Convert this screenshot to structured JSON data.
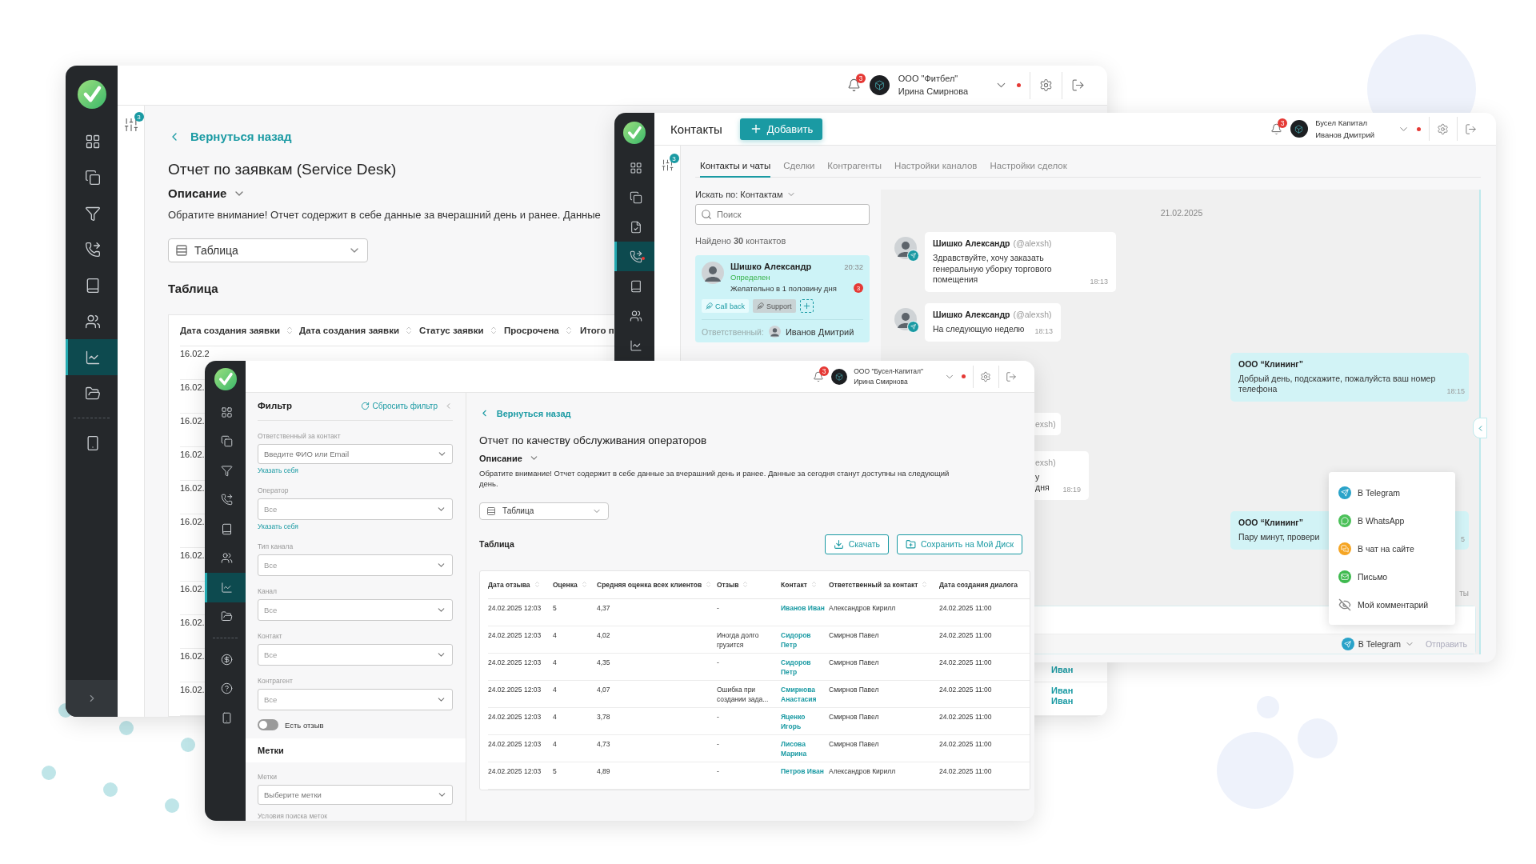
{
  "back_window": {
    "sidebar": {
      "items": [
        {
          "kind": "grid",
          "selected": false
        },
        {
          "kind": "clipboard",
          "selected": false
        },
        {
          "kind": "funnel",
          "selected": false
        },
        {
          "kind": "phone",
          "selected": false
        },
        {
          "kind": "book",
          "selected": false
        },
        {
          "kind": "people",
          "selected": false
        },
        {
          "kind": "chart",
          "selected": true
        },
        {
          "kind": "folder",
          "selected": false
        }
      ],
      "extra_items": [
        {
          "kind": "mobile",
          "selected": false
        }
      ]
    },
    "filter_badge": "3",
    "header": {
      "notification_count": "3",
      "org": "ООО \"Фитбел\"",
      "user": "Ирина Смирнова"
    },
    "back_link": "Вернуться назад",
    "title": "Отчет по заявкам (Service Desk)",
    "description_toggle": "Описание",
    "notice": "Обратите внимание! Отчет содержит в себе данные за вчерашний день и ранее. Данные",
    "view_select": "Таблица",
    "table_title": "Таблица",
    "table": {
      "columns": [
        {
          "label": "Дата создания заявки",
          "sortable": true
        },
        {
          "label": "Дата создания заявки",
          "sortable": true
        },
        {
          "label": "Статус заявки",
          "sortable": true
        },
        {
          "label": "Просрочена",
          "sortable": true
        },
        {
          "label": "Итого п"
        }
      ],
      "rows": [
        {
          "column_1": "16.02.2"
        },
        {
          "column_1": "16.02."
        },
        {
          "column_1": "16.02."
        },
        {
          "column_1": "16.02."
        },
        {
          "column_1": "16.02."
        },
        {
          "column_1": "16.02."
        },
        {
          "column_1": "16.02."
        },
        {
          "column_1": "16.02."
        },
        {
          "column_1": "16.02."
        },
        {
          "column_1": "16.02.",
          "column_6": "Иван"
        },
        {
          "column_1": "16.02.",
          "column_6": "Иван Иван"
        }
      ]
    }
  },
  "contacts_window": {
    "sidebar": {
      "items": [
        {
          "kind": "grid",
          "selected": false,
          "alert": false
        },
        {
          "kind": "clipboard",
          "selected": false,
          "alert": false
        },
        {
          "kind": "report",
          "selected": false,
          "alert": false
        },
        {
          "kind": "phone",
          "selected": true,
          "alert": true
        },
        {
          "kind": "book",
          "selected": false,
          "alert": false
        },
        {
          "kind": "people",
          "selected": false,
          "alert": false
        },
        {
          "kind": "chart",
          "selected": false,
          "alert": false
        }
      ]
    },
    "title": "Контакты",
    "add_button": "Добавить",
    "filter_badge": "3",
    "header": {
      "notification_count": "3",
      "org": "Бусел Капитал",
      "user": "Иванов Дмитрий"
    },
    "tabs": [
      {
        "label": "Контакты и чаты",
        "selected": true
      },
      {
        "label": "Сделки",
        "selected": false
      },
      {
        "label": "Контрагенты",
        "selected": false
      },
      {
        "label": "Настройки каналов",
        "selected": false
      },
      {
        "label": "Настройки сделок",
        "selected": false
      }
    ],
    "search_by": "Искать по: Контактам",
    "search": {
      "placeholder": "Поиск"
    },
    "found": "Найдено **30** контактов",
    "contact_card": {
      "name": "Шишко Александр",
      "time": "20:32",
      "status": "Определен",
      "note": "Желательно в 1 половину дня",
      "unread": "3",
      "tags": [
        {
          "label": "Call back",
          "kind": "callback"
        },
        {
          "label": "Support",
          "kind": "support"
        }
      ],
      "responsible_label": "Ответственный:",
      "responsible": "Иванов Дмитрий"
    },
    "chat": {
      "date": "21.02.2025",
      "messages": [
        {
          "kind": "incoming",
          "author": "Шишко Александр",
          "handle": "(@alexsh)",
          "text": "Здравствуйте, хочу заказать генеральную уборку торгового помещения",
          "time": "18:13"
        },
        {
          "kind": "incoming",
          "author": "Шишко Александр",
          "handle": "(@alexsh)",
          "text": "На следующую неделю",
          "time": "18:13"
        },
        {
          "kind": "outgoing",
          "author": "ООО “Клининг”",
          "text": "Добрый день, подскажите, пожалуйста ваш номер телефона",
          "time": "18:15"
        },
        {
          "kind": "incoming_cut",
          "handle": "exsh)"
        },
        {
          "kind": "incoming_cut",
          "handle": "exsh)",
          "text": "у дня",
          "time": "18:19"
        },
        {
          "kind": "outgoing",
          "author": "ООО “Клининг”",
          "text": "Пару минут, провери",
          "time": "5"
        }
      ],
      "status_fragment": "ты",
      "channel_select": "В Telegram",
      "send_button": {
        "label": "Отправить",
        "disabled": true
      }
    },
    "channel_menu": [
      {
        "kind": "telegram",
        "label": "В Telegram"
      },
      {
        "kind": "whatsapp",
        "label": "В WhatsApp"
      },
      {
        "kind": "site",
        "label": "В чат на сайте"
      },
      {
        "kind": "mail",
        "label": "Письмо"
      },
      {
        "kind": "comment",
        "label": "Мой комментарий"
      }
    ]
  },
  "front_window": {
    "sidebar": {
      "items": [
        {
          "kind": "grid",
          "selected": false
        },
        {
          "kind": "clipboard",
          "selected": false
        },
        {
          "kind": "funnel",
          "selected": false
        },
        {
          "kind": "phone",
          "selected": false
        },
        {
          "kind": "book",
          "selected": false
        },
        {
          "kind": "people",
          "selected": false
        },
        {
          "kind": "chart",
          "selected": true
        },
        {
          "kind": "folder",
          "selected": false
        }
      ],
      "extra_items": [
        {
          "kind": "dollar",
          "selected": false
        },
        {
          "kind": "help",
          "selected": false
        },
        {
          "kind": "mobile",
          "selected": false
        }
      ]
    },
    "header": {
      "notification_count": "3",
      "org": "ООО \"Бусел-Капитал\"",
      "user": "Ирина Смирнова"
    },
    "filter": {
      "title": "Фильтр",
      "reset": "Сбросить фильтр",
      "fields": [
        {
          "label": "Ответственный за контакт",
          "placeholder": "Введите ФИО или Email",
          "link": "Указать себя"
        },
        {
          "label": "Оператор",
          "value": "Все",
          "link": "Указать себя"
        },
        {
          "label": "Тип канала",
          "value": "Все"
        },
        {
          "label": "Канал",
          "value": "Все"
        },
        {
          "label": "Контакт",
          "value": "Все"
        },
        {
          "label": "Контрагент",
          "value": "Все"
        }
      ],
      "toggle": {
        "label": "Есть отзыв",
        "on": false
      },
      "tags_section": "Метки",
      "tags_field": {
        "label": "Метки",
        "placeholder": "Выберите метки"
      },
      "tag_conditions_label": "Условия поиска меток"
    },
    "back_link": "Вернуться назад",
    "title": "Отчет по качеству обслуживания операторов",
    "description_toggle": "Описание",
    "notice": "Обратите внимание! Отчет содержит в себе данные за вчерашний день и ранее. Данные за сегодня станут доступны на следующий день.",
    "view_select": "Таблица",
    "table_title": "Таблица",
    "download_button": "Скачать",
    "save_button": "Сохранить на Мой Диск",
    "table": {
      "columns": [
        {
          "label": "Дата отзыва",
          "kind": "text",
          "sortable": true
        },
        {
          "label": "Оценка",
          "kind": "text",
          "sortable": true
        },
        {
          "label": "Средняя оценка всех клиентов",
          "kind": "text",
          "sortable": true
        },
        {
          "label": "Отзыв",
          "kind": "text",
          "sortable": true
        },
        {
          "label": "Контакт",
          "kind": "link",
          "sortable": true
        },
        {
          "label": "Ответственный за контакт",
          "kind": "text",
          "sortable": true
        },
        {
          "label": "Дата создания диалога",
          "kind": "text",
          "sortable": false
        }
      ],
      "rows": [
        [
          "24.02.2025 12:03",
          "5",
          "4,37",
          "-",
          "Иванов Иван",
          "Александров Кирилл",
          "24.02.2025 11:00"
        ],
        [
          "24.02.2025 12:03",
          "4",
          "4,02",
          "Иногда долго грузится",
          "Сидоров Петр",
          "Смирнов Павел",
          "24.02.2025 11:00"
        ],
        [
          "24.02.2025 12:03",
          "4",
          "4,35",
          "-",
          "Сидоров Петр",
          "Смирнов Павел",
          "24.02.2025 11:00"
        ],
        [
          "24.02.2025 12:03",
          "4",
          "4,07",
          "Ошибка при создании зада...",
          "Смирнова Анастасия",
          "Смирнов Павел",
          "24.02.2025 11:00"
        ],
        [
          "24.02.2025 12:03",
          "4",
          "3,78",
          "-",
          "Яценко Игорь",
          "Смирнов Павел",
          "24.02.2025 11:00"
        ],
        [
          "24.02.2025 12:03",
          "4",
          "4,73",
          "-",
          "Лисова Марина",
          "Смирнов Павел",
          "24.02.2025 11:00"
        ],
        [
          "24.02.2025 12:03",
          "5",
          "4,89",
          "-",
          "Петров Иван",
          "Александров Кирилл",
          "24.02.2025 11:00"
        ]
      ]
    }
  }
}
